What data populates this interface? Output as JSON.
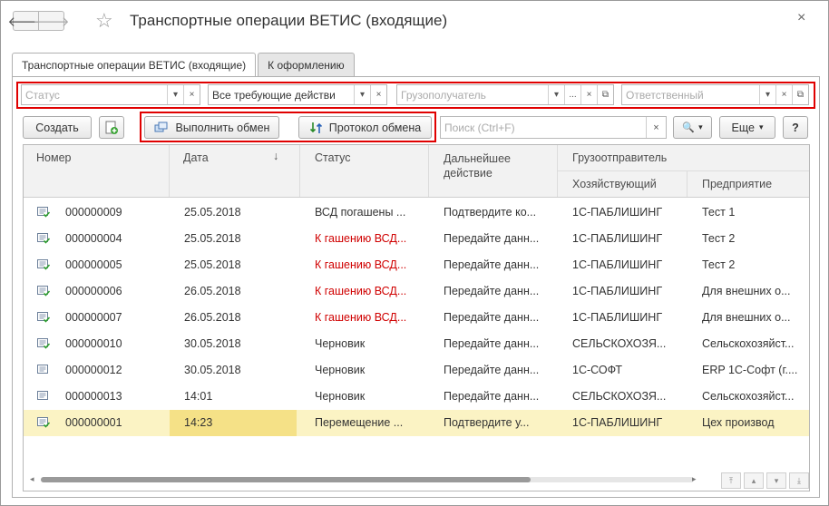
{
  "window": {
    "title": "Транспортные операции ВЕТИС (входящие)",
    "back_glyph": "🡐",
    "forward_glyph": "🡒",
    "star_glyph": "☆",
    "close_glyph": "×"
  },
  "tabs": [
    {
      "label": "Транспортные операции ВЕТИС (входящие)",
      "active": true
    },
    {
      "label": "К оформлению",
      "active": false
    }
  ],
  "filters": {
    "status_placeholder": "Статус",
    "action_value": "Все требующие действи",
    "consignee_placeholder": "Грузополучатель",
    "responsible_placeholder": "Ответственный",
    "dropdown_glyph": "▾",
    "clear_glyph": "×",
    "ellipsis_glyph": "...",
    "open_glyph": "⧉"
  },
  "toolbar": {
    "create_label": "Создать",
    "exchange_label": "Выполнить обмен",
    "protocol_label": "Протокол обмена",
    "search_placeholder": "Поиск (Ctrl+F)",
    "search_clear_glyph": "×",
    "search_glyph": "🔍",
    "more_label": "Еще",
    "more_glyph": "▾",
    "help_label": "?"
  },
  "table": {
    "headers": {
      "number": "Номер",
      "date": "Дата",
      "sort_glyph": "↓",
      "status": "Статус",
      "next_action": "Дальнейшее действие",
      "shipper": "Грузоотправитель",
      "entity": "Хозяйствующий",
      "enterprise": "Предприятие"
    },
    "rows": [
      {
        "number": "000000009",
        "date": "25.05.2018",
        "status": "ВСД погашены ...",
        "status_red": false,
        "action": "Подтвердите ко...",
        "entity": "1С-ПАБЛИШИНГ",
        "enterprise": "Тест 1",
        "icon": "doc-check-icon",
        "selected": false
      },
      {
        "number": "000000004",
        "date": "25.05.2018",
        "status": "К гашению ВСД...",
        "status_red": true,
        "action": "Передайте данн...",
        "entity": "1С-ПАБЛИШИНГ",
        "enterprise": "Тест 2",
        "icon": "doc-check-icon",
        "selected": false
      },
      {
        "number": "000000005",
        "date": "25.05.2018",
        "status": "К гашению ВСД...",
        "status_red": true,
        "action": "Передайте данн...",
        "entity": "1С-ПАБЛИШИНГ",
        "enterprise": "Тест 2",
        "icon": "doc-check-icon",
        "selected": false
      },
      {
        "number": "000000006",
        "date": "26.05.2018",
        "status": "К гашению ВСД...",
        "status_red": true,
        "action": "Передайте данн...",
        "entity": "1С-ПАБЛИШИНГ",
        "enterprise": "Для внешних о...",
        "icon": "doc-check-icon",
        "selected": false
      },
      {
        "number": "000000007",
        "date": "26.05.2018",
        "status": "К гашению ВСД...",
        "status_red": true,
        "action": "Передайте данн...",
        "entity": "1С-ПАБЛИШИНГ",
        "enterprise": "Для внешних о...",
        "icon": "doc-check-icon",
        "selected": false
      },
      {
        "number": "000000010",
        "date": "30.05.2018",
        "status": "Черновик",
        "status_red": false,
        "action": "Передайте данн...",
        "entity": "СЕЛЬСКОХОЗЯ...",
        "enterprise": "Сельскохозяйст...",
        "icon": "doc-check-icon",
        "selected": false
      },
      {
        "number": "000000012",
        "date": "30.05.2018",
        "status": "Черновик",
        "status_red": false,
        "action": "Передайте данн...",
        "entity": "1С-СОФТ",
        "enterprise": "ERP 1С-Софт (г....",
        "icon": "doc-icon",
        "selected": false
      },
      {
        "number": "000000013",
        "date": "14:01",
        "status": "Черновик",
        "status_red": false,
        "action": "Передайте данн...",
        "entity": "СЕЛЬСКОХОЗЯ...",
        "enterprise": "Сельскохозяйст...",
        "icon": "doc-icon",
        "selected": false
      },
      {
        "number": "000000001",
        "date": "14:23",
        "status": "Перемещение ...",
        "status_red": false,
        "action": "Подтвердите у...",
        "entity": "1С-ПАБЛИШИНГ",
        "enterprise": "Цех производ",
        "icon": "doc-check-icon",
        "selected": true
      }
    ]
  },
  "scroll": {
    "left_glyph": "◂",
    "right_glyph": "▸",
    "first_glyph": "⤒",
    "up_glyph": "▴",
    "down_glyph": "▾",
    "last_glyph": "⤓"
  },
  "colors": {
    "highlight_border": "#e00000",
    "status_red": "#d00000",
    "selected_row": "#fbf3c4",
    "selected_cell": "#f5e187"
  }
}
